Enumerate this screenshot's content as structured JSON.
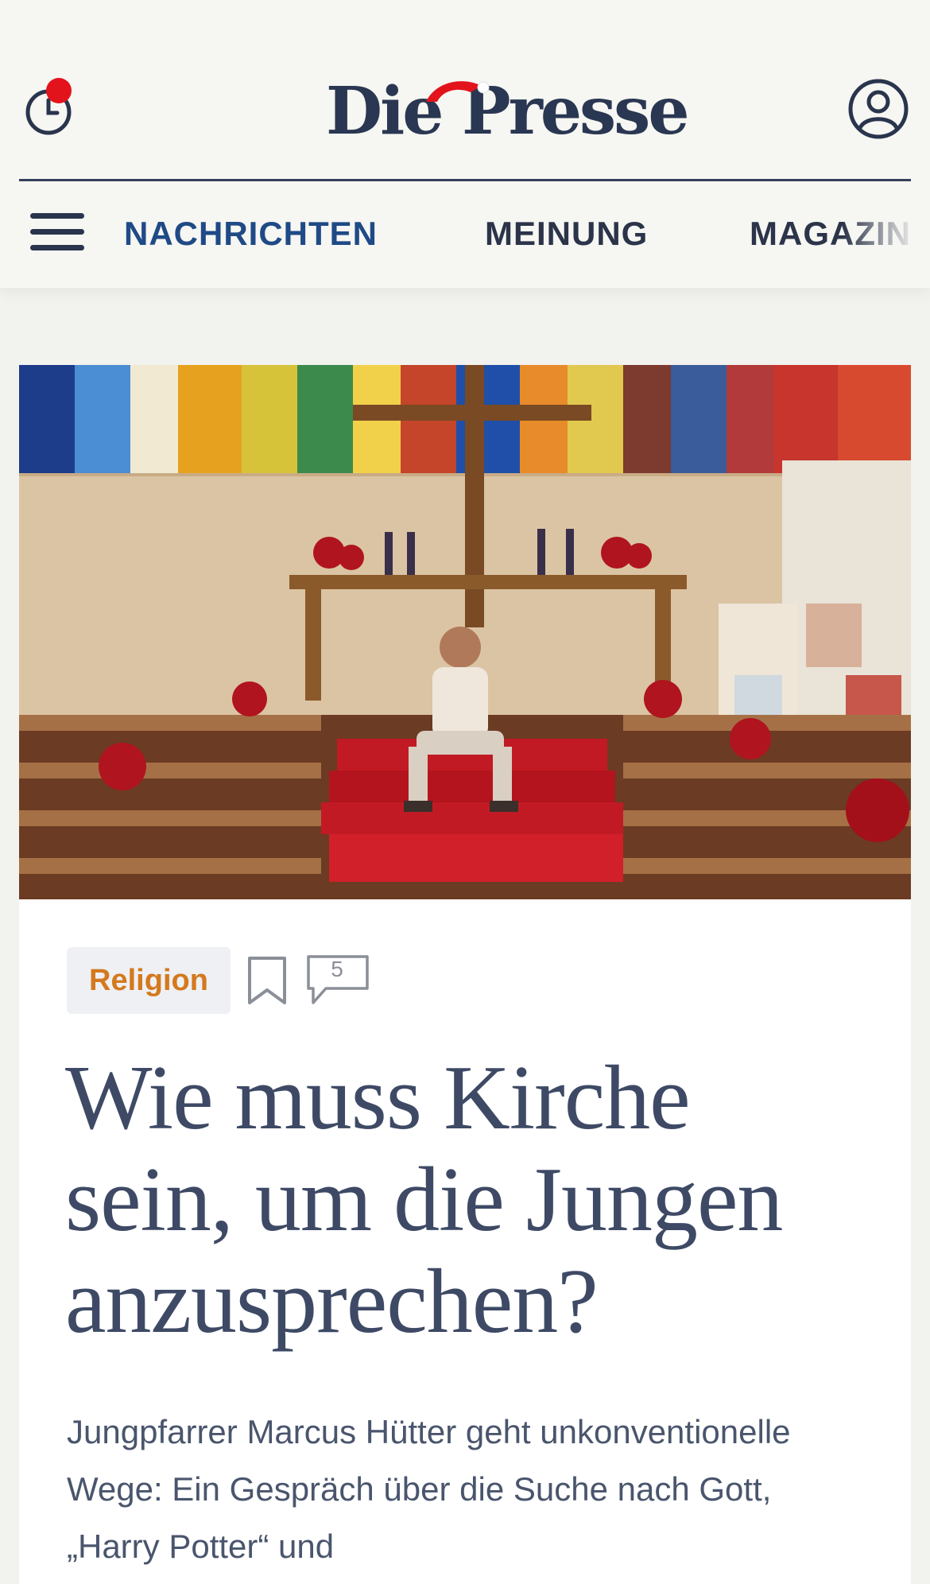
{
  "app": {
    "logo_text": "Die Presse"
  },
  "header": {
    "icons": {
      "history": "clock-icon",
      "profile": "user-icon",
      "menu": "hamburger-icon"
    },
    "notification_dot_color": "#e3131c"
  },
  "nav": {
    "items": [
      {
        "label": "NACHRICHTEN",
        "active": true
      },
      {
        "label": "MEINUNG",
        "active": false
      },
      {
        "label": "MAGAZIN",
        "active": false
      }
    ]
  },
  "article": {
    "category": "Religion",
    "comment_count": "5",
    "headline": "Wie muss Kirche sein, um die Jungen anzusprechen?",
    "teaser": "Jungpfarrer Marcus Hütter geht unkonventionelle Wege: Ein Gespräch über die Suche nach Gott, „Harry Potter“ und"
  },
  "colors": {
    "brand_blue": "#1f4a86",
    "category_orange": "#d4791e",
    "headline": "#3e4a65"
  }
}
